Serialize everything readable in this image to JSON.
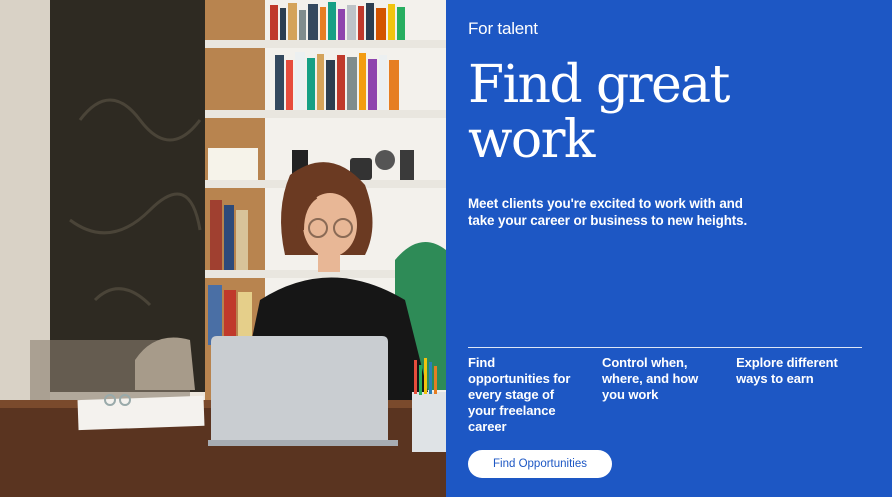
{
  "hero": {
    "image_alt": "Woman working on a laptop in a room with bookshelves",
    "eyebrow": "For talent",
    "headline": "Find great work",
    "description": "Meet clients you're excited to work with and take your career or business to new heights.",
    "features": [
      "Find opportunities for every stage of your freelance career",
      "Control when, where, and how you work",
      "Explore different ways to earn"
    ],
    "cta_label": "Find Opportunities"
  },
  "colors": {
    "panel_bg": "#1d57c4",
    "panel_text": "#ffffff",
    "cta_bg": "#ffffff",
    "cta_text": "#1d57c4"
  }
}
